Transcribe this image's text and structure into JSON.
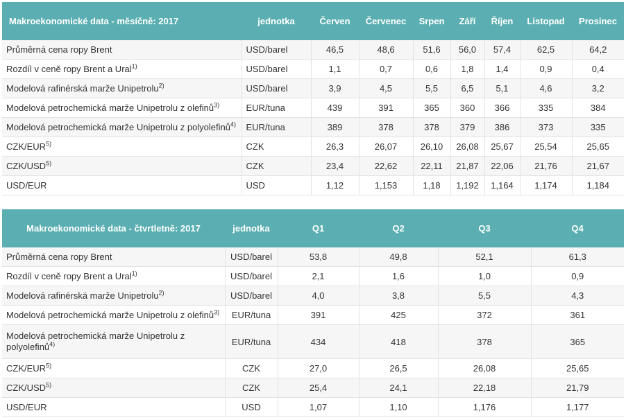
{
  "monthly": {
    "title": "Makroekonomické data - měsíčně: 2017",
    "unit_header": "jednotka",
    "months": [
      "Červen",
      "Červenec",
      "Srpen",
      "Září",
      "Říjen",
      "Listopad",
      "Prosinec"
    ],
    "rows": [
      {
        "label": "Průměrná cena ropy Brent",
        "sup": "",
        "unit": "USD/barel",
        "values": [
          "46,5",
          "48,6",
          "51,6",
          "56,0",
          "57,4",
          "62,5",
          "64,2"
        ]
      },
      {
        "label": "Rozdíl v ceně ropy Brent a Ural",
        "sup": "1)",
        "unit": "USD/barel",
        "values": [
          "1,1",
          "0,7",
          "0,6",
          "1,8",
          "1,4",
          "0,9",
          "0,4"
        ]
      },
      {
        "label": "Modelová rafinérská marže Unipetrolu",
        "sup": "2)",
        "unit": "USD/barel",
        "values": [
          "3,9",
          "4,5",
          "5,5",
          "6,5",
          "5,1",
          "4,6",
          "3,2"
        ]
      },
      {
        "label": "Modelová petrochemická marže Unipetrolu z olefinů",
        "sup": "3)",
        "unit": "EUR/tuna",
        "values": [
          "439",
          "391",
          "365",
          "360",
          "366",
          "335",
          "384"
        ]
      },
      {
        "label": "Modelová petrochemická marže Unipetrolu z polyolefinů",
        "sup": "4)",
        "unit": "EUR/tuna",
        "values": [
          "389",
          "378",
          "378",
          "379",
          "386",
          "373",
          "335"
        ]
      },
      {
        "label": "CZK/EUR",
        "sup": "5)",
        "unit": "CZK",
        "values": [
          "26,3",
          "26,07",
          "26,10",
          "26,08",
          "25,67",
          "25,54",
          "25,65"
        ]
      },
      {
        "label": "CZK/USD",
        "sup": "5)",
        "unit": "CZK",
        "values": [
          "23,4",
          "22,62",
          "22,11",
          "21,87",
          "22,06",
          "21,76",
          "21,67"
        ]
      },
      {
        "label": "USD/EUR",
        "sup": "",
        "unit": "USD",
        "values": [
          "1,12",
          "1,153",
          "1,18",
          "1,192",
          "1,164",
          "1,174",
          "1,184"
        ]
      }
    ]
  },
  "quarterly": {
    "title": "Makroekonomické data - čtvrtletně: 2017",
    "unit_header": "jednotka",
    "quarters": [
      "Q1",
      "Q2",
      "Q3",
      "Q4"
    ],
    "rows": [
      {
        "label": "Průměrná cena ropy Brent",
        "sup": "",
        "unit": "USD/barel",
        "values": [
          "53,8",
          "49,8",
          "52,1",
          "61,3"
        ]
      },
      {
        "label": "Rozdíl v ceně ropy Brent a Ural",
        "sup": "1)",
        "unit": "USD/barel",
        "values": [
          "2,1",
          "1,6",
          "1,0",
          "0,9"
        ]
      },
      {
        "label": "Modelová rafinérská marže Unipetrolu",
        "sup": "2)",
        "unit": "USD/barel",
        "values": [
          "4,0",
          "3,8",
          "5,5",
          "4,3"
        ]
      },
      {
        "label": "Modelová petrochemická marže Unipetrolu z olefinů",
        "sup": "3)",
        "unit": "EUR/tuna",
        "values": [
          "391",
          "425",
          "372",
          "361"
        ]
      },
      {
        "label": "Modelová petrochemická marže Unipetrolu z polyolefinů",
        "sup": "4)",
        "unit": "EUR/tuna",
        "values": [
          "434",
          "418",
          "378",
          "365"
        ]
      },
      {
        "label": "CZK/EUR",
        "sup": "5)",
        "unit": "CZK",
        "values": [
          "27,0",
          "26,5",
          "26,08",
          "25,65"
        ]
      },
      {
        "label": "CZK/USD",
        "sup": "5)",
        "unit": "CZK",
        "values": [
          "25,4",
          "24,1",
          "22,18",
          "21,79"
        ]
      },
      {
        "label": "USD/EUR",
        "sup": "",
        "unit": "USD",
        "values": [
          "1,07",
          "1,10",
          "1,176",
          "1,177"
        ]
      }
    ]
  }
}
